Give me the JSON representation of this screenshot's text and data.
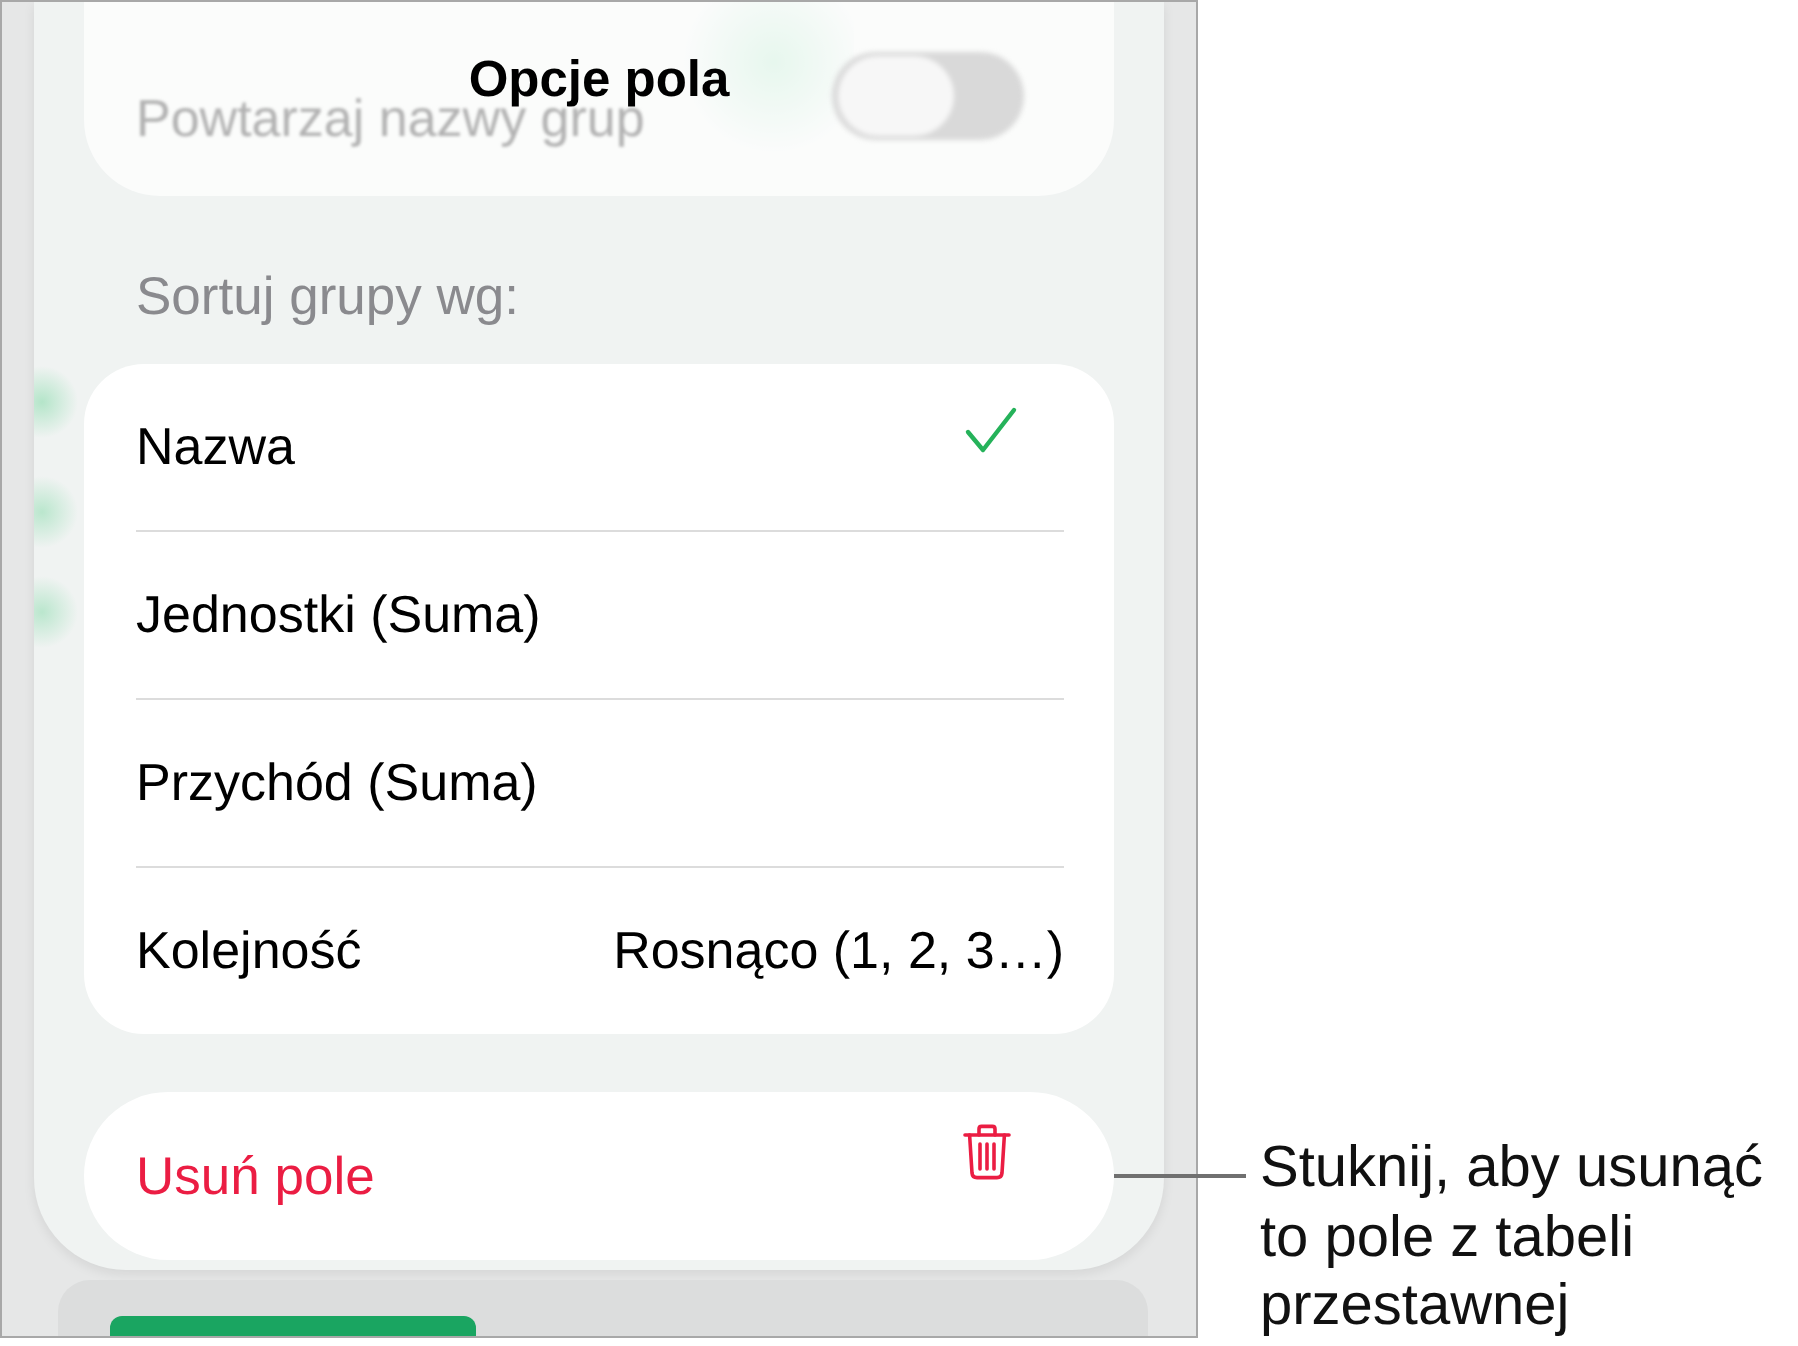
{
  "panel": {
    "title": "Opcje pola"
  },
  "repeat_group_names": {
    "label": "Powtarzaj nazwy grup",
    "on": false
  },
  "sort_section": {
    "label": "Sortuj grupy wg:",
    "options": [
      {
        "label": "Nazwa",
        "selected": true
      },
      {
        "label": "Jednostki (Suma)",
        "selected": false
      },
      {
        "label": "Przychód (Suma)",
        "selected": false
      }
    ],
    "order": {
      "label": "Kolejność",
      "value": "Rosnąco (1, 2, 3…)"
    }
  },
  "delete_button": {
    "label": "Usuń pole"
  },
  "callout": {
    "text": "Stuknij, aby usunąć\nto pole z tabeli\nprzestawnej"
  }
}
